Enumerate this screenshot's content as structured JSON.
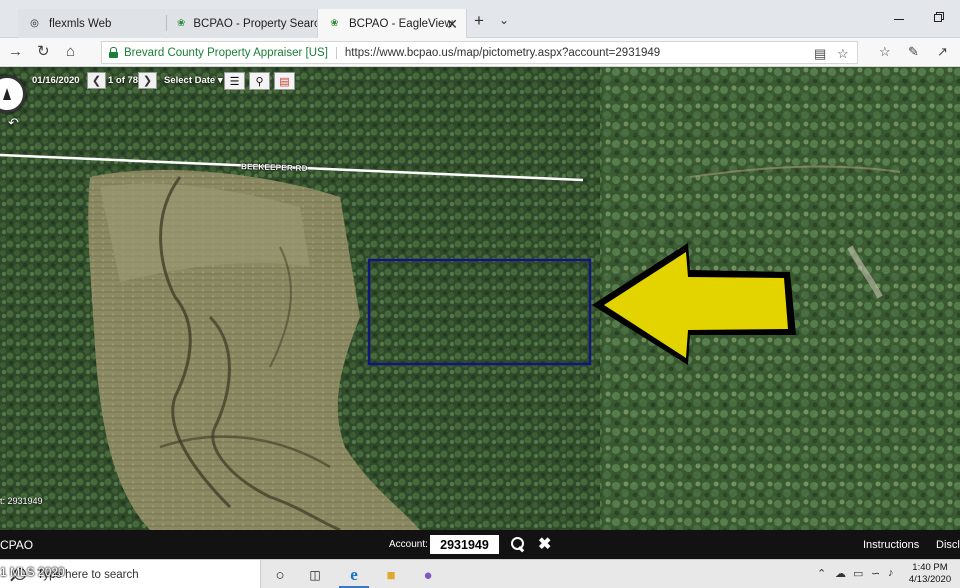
{
  "browser": {
    "tabs": [
      {
        "label": "flexmls Web",
        "active": false
      },
      {
        "label": "BCPAO - Property Search",
        "active": false
      },
      {
        "label": "BCPAO - EagleView",
        "active": true
      }
    ],
    "site_identity": "Brevard County Property Appraiser [US]",
    "url": "https://www.bcpao.us/map/pictometry.aspx?account=2931949"
  },
  "map": {
    "date": "01/16/2020",
    "page_label": "1 of 78",
    "select_date": "Select Date",
    "road_label": "BEEKEEPER RD",
    "attribution": "t: 2931949"
  },
  "footer": {
    "brand": "CPAO",
    "account_label": "Account:",
    "account_value": "2931949",
    "instructions": "Instructions",
    "disclaimer": "Discla"
  },
  "taskbar": {
    "search_placeholder": "Type here to search",
    "time": "1:40 PM",
    "date": "4/13/2020"
  },
  "overlay_text": "1 MLS 2020",
  "colors": {
    "parcel_outline": "#12187a",
    "arrow_fill": "#e3d400",
    "footer_bg": "#121212",
    "road_line": "#ffffff"
  }
}
